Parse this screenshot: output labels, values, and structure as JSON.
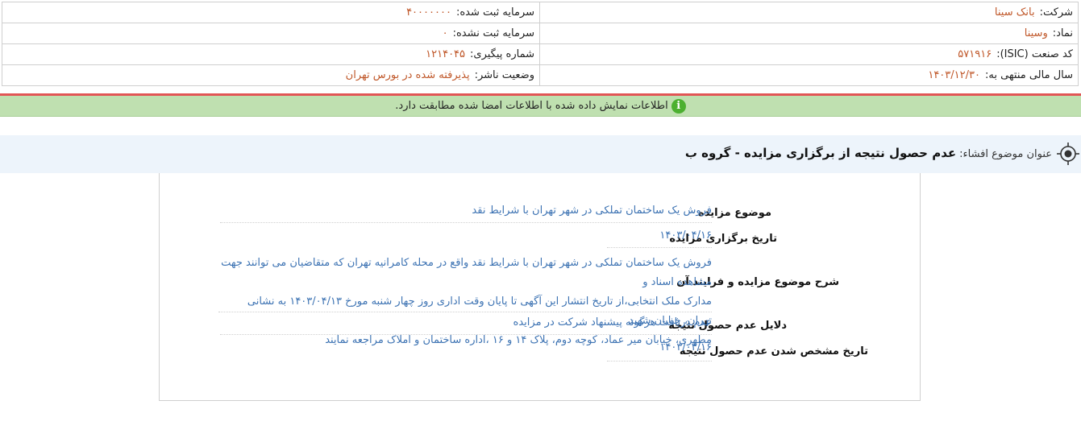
{
  "header": {
    "rows": [
      {
        "right_label": "شرکت:",
        "right_value": "بانک سینا",
        "left_label": "سرمایه ثبت شده:",
        "left_value": "۴۰۰۰۰۰۰۰"
      },
      {
        "right_label": "نماد:",
        "right_value": "وسینا",
        "left_label": "سرمایه ثبت نشده:",
        "left_value": "۰"
      },
      {
        "right_label": "کد صنعت (ISIC):",
        "right_value": "۵۷۱۹۱۶",
        "left_label": "شماره پیگیری:",
        "left_value": "۱۲۱۴۰۴۵"
      },
      {
        "right_label": "سال مالی منتهی به:",
        "right_value": "۱۴۰۳/۱۲/۳۰",
        "left_label": "وضعیت ناشر:",
        "left_value": "پذیرفته شده در بورس تهران"
      }
    ]
  },
  "notice": {
    "icon": "info-icon",
    "text": "اطلاعات نمایش داده شده با اطلاعات امضا شده مطابقت دارد."
  },
  "title": {
    "label": "عنوان موضوع افشاء:",
    "value": "عدم حصول نتیجه از برگزاری مزایده - گروه ب"
  },
  "fields": [
    {
      "label": "موضوع مزایده",
      "value": "فروش یک ساختمان تملکی در شهر تهران با شرایط نقد"
    },
    {
      "label": "تاریخ برگزاری مزایده",
      "value": "۱۴۰۳/۰۴/۱۶"
    },
    {
      "label": "شرح موضوع مزایده و فرایند آن",
      "lines": [
        "فروش یک ساختمان تملکی در شهر تهران با شرایط نقد واقع در محله کامرانیه تهران که متقاضیان می توانند جهت مشاهده اسناد و",
        "مدارک ملک انتخابی،از تاریخ انتشار این آگهی تا پایان وقت اداری روز چهار شنبه مورخ ۱۴۰۳/۰۴/۱۳ به نشانی تهران، خیابان شهید",
        "مطهری، خیابان میر عماد، کوچه دوم، پلاک ۱۴ و ۱۶ ،اداره ساختمان و املاک مراجعه نمایند"
      ]
    },
    {
      "label": "دلایل عدم حصول نتیجه",
      "value": "عدم دریافت هرگونه پیشنهاد شرکت در مزایده"
    },
    {
      "label": "تاریخ مشخص شدن عدم حصول نتیجه",
      "value": "۱۴۰۳/۰۴/۱۶"
    }
  ],
  "colors": {
    "accent_value": "#c0582a",
    "link_blue": "#3d73b3",
    "notice_green": "#bfe0b0",
    "alert_red": "#e15555"
  }
}
